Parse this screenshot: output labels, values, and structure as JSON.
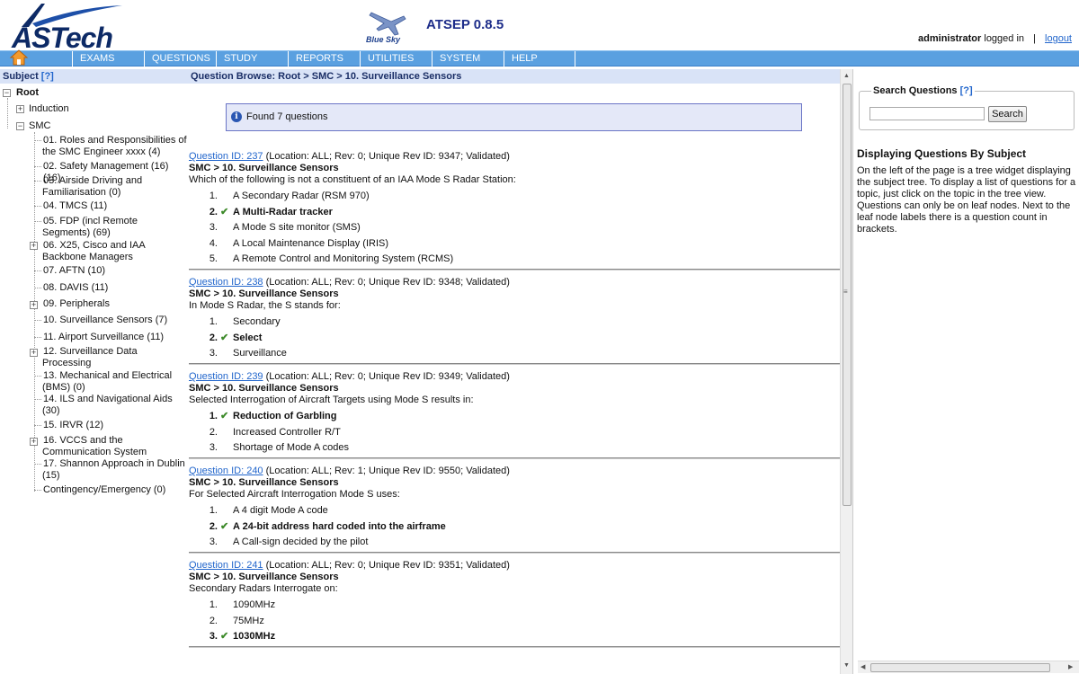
{
  "header": {
    "logo_text": "ASTech",
    "bluesky_label": "Blue Sky",
    "app_version": "ATSEP 0.8.5",
    "user_name": "administrator",
    "logged_in_text": "logged in",
    "separator": "|",
    "logout_label": "logout"
  },
  "menu": {
    "items": [
      "EXAMS",
      "QUESTIONS",
      "STUDY",
      "REPORTS",
      "UTILITIES",
      "SYSTEM",
      "HELP"
    ]
  },
  "left": {
    "title": "Subject",
    "help_link": "[?]",
    "root": "Root",
    "nodes": [
      "Induction",
      "SMC",
      "01. Roles and Responsibilities of",
      "the SMC Engineer xxxx (4)",
      "02. Safety Management (16) (16)",
      "03. Airside Driving and",
      "Familiarisation (0)",
      "04. TMCS (11)",
      "05. FDP (incl Remote",
      "Segments) (69)",
      "06. X25, Cisco and IAA",
      "Backbone Managers",
      "07. AFTN (10)",
      "08. DAVIS (11)",
      "09. Peripherals",
      "10. Surveillance Sensors (7)",
      "11. Airport Surveillance (11)",
      "12. Surveillance Data",
      "Processing",
      "13. Mechanical and Electrical",
      "(BMS) (0)",
      "14. ILS and Navigational Aids",
      "(30)",
      "15. IRVR (12)",
      "16. VCCS and the",
      "Communication System",
      "17. Shannon Approach in Dublin",
      "(15)",
      "Contingency/Emergency (0)"
    ]
  },
  "center": {
    "title": "Question Browse: Root > SMC > 10. Surveillance Sensors",
    "info_text": "Found 7 questions",
    "questions": [
      {
        "id_label": "Question ID: 237",
        "meta": " (Location: ALL; Rev: 0; Unique Rev ID: 9347; Validated)",
        "path": "SMC > 10. Surveillance Sensors",
        "text": "Which of the following is not a constituent of an IAA Mode S Radar Station:",
        "answers": [
          {
            "num": "1.",
            "text": "A Secondary Radar (RSM 970)"
          },
          {
            "num": "2.",
            "text": "A Multi-Radar tracker"
          },
          {
            "num": "3.",
            "text": "A Mode S site monitor (SMS)"
          },
          {
            "num": "4.",
            "text": "A Local Maintenance Display (IRIS)"
          },
          {
            "num": "5.",
            "text": "A Remote Control and Monitoring System (RCMS)"
          }
        ]
      },
      {
        "id_label": "Question ID: 238",
        "meta": " (Location: ALL; Rev: 0; Unique Rev ID: 9348; Validated)",
        "path": "SMC > 10. Surveillance Sensors",
        "text": "In Mode S Radar, the S stands for:",
        "answers": [
          {
            "num": "1.",
            "text": "Secondary"
          },
          {
            "num": "2.",
            "text": "Select"
          },
          {
            "num": "3.",
            "text": "Surveillance"
          }
        ]
      },
      {
        "id_label": "Question ID: 239",
        "meta": " (Location: ALL; Rev: 0; Unique Rev ID: 9349; Validated)",
        "path": "SMC > 10. Surveillance Sensors",
        "text": "Selected Interrogation of Aircraft Targets using Mode S results in:",
        "answers": [
          {
            "num": "1.",
            "text": "Reduction of Garbling"
          },
          {
            "num": "2.",
            "text": "Increased Controller R/T"
          },
          {
            "num": "3.",
            "text": "Shortage of Mode A codes"
          }
        ]
      },
      {
        "id_label": "Question ID: 240",
        "meta": " (Location: ALL; Rev: 1; Unique Rev ID: 9550; Validated)",
        "path": "SMC > 10. Surveillance Sensors",
        "text": "For Selected Aircraft Interrogation Mode S uses:",
        "answers": [
          {
            "num": "1.",
            "text": "A 4 digit Mode A code"
          },
          {
            "num": "2.",
            "text": "A 24-bit address hard coded into the airframe"
          },
          {
            "num": "3.",
            "text": "A Call-sign decided by the pilot"
          }
        ]
      },
      {
        "id_label": "Question ID: 241",
        "meta": " (Location: ALL; Rev: 0; Unique Rev ID: 9351; Validated)",
        "path": "SMC > 10. Surveillance Sensors",
        "text": "Secondary Radars Interrogate on:",
        "answers": [
          {
            "num": "1.",
            "text": "1090MHz"
          },
          {
            "num": "2.",
            "text": "75MHz"
          },
          {
            "num": "3.",
            "text": "1030MHz"
          }
        ]
      }
    ]
  },
  "right": {
    "search_legend": "Search Questions",
    "help_link": "[?]",
    "search_value": "",
    "search_button": "Search",
    "help_title": "Displaying Questions By Subject",
    "help_body": "On the left of the page is a tree widget displaying the subject tree. To display a list of questions for a topic, just click on the topic in the tree view. Questions can only be on leaf nodes. Next to the leaf node labels there is a question count in brackets."
  },
  "colors": {
    "menu_bar": "#5aa0e0",
    "panel_title": "#d9e3f7",
    "info_box": "#e4e8f8",
    "link": "#2266cc",
    "check": "#3d8a2a"
  }
}
